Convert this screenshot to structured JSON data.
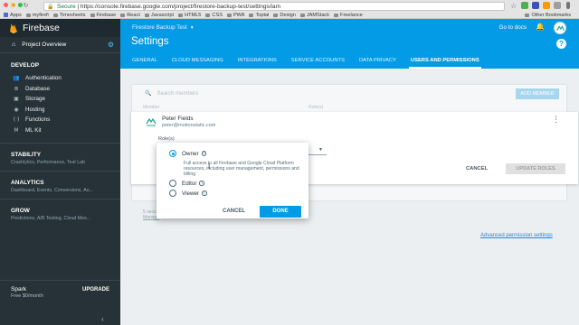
{
  "browser": {
    "url_prefix": "Secure",
    "url": "https://console.firebase.google.com/project/firestore-backup-test/settings/iam",
    "bookmarks": [
      "Apps",
      "myfirefi",
      "Timesheets",
      "Firebase",
      "React",
      "Javascript",
      "HTML5",
      "CSS",
      "PWA",
      "Toptal",
      "Design",
      "JAMStack",
      "Freelance"
    ],
    "other_bookmarks": "Other Bookmarks"
  },
  "sidebar": {
    "brand": "Firebase",
    "project_overview": "Project Overview",
    "develop_title": "DEVELOP",
    "develop_items": [
      {
        "label": "Authentication",
        "icon": "authentication-icon"
      },
      {
        "label": "Database",
        "icon": "database-icon"
      },
      {
        "label": "Storage",
        "icon": "storage-icon"
      },
      {
        "label": "Hosting",
        "icon": "hosting-icon"
      },
      {
        "label": "Functions",
        "icon": "functions-icon"
      },
      {
        "label": "ML Kit",
        "icon": "ml-kit-icon"
      }
    ],
    "groups": [
      {
        "title": "STABILITY",
        "sub": "Crashlytics, Performance, Test Lab"
      },
      {
        "title": "ANALYTICS",
        "sub": "Dashboard, Events, Conversions, Au..."
      },
      {
        "title": "GROW",
        "sub": "Predictions, A/B Testing, Cloud Mes..."
      }
    ],
    "plan": "Spark",
    "price": "Free $0/month",
    "upgrade": "UPGRADE"
  },
  "header": {
    "project": "Firestore Backup Test",
    "go_to_docs": "Go to docs",
    "title": "Settings",
    "tabs": [
      "GENERAL",
      "CLOUD MESSAGING",
      "INTEGRATIONS",
      "SERVICE ACCOUNTS",
      "DATA PRIVACY",
      "USERS AND PERMISSIONS"
    ],
    "active_tab": "USERS AND PERMISSIONS"
  },
  "members": {
    "search_placeholder": "Search members",
    "add_member": "ADD MEMBER",
    "col_member": "Member",
    "col_role": "Role(s)",
    "summary": "5 secs",
    "summary2": "Manage"
  },
  "member": {
    "name": "Peter Fields",
    "email": "peter@motionstatic.com",
    "roles_label": "Role(s)",
    "cancel": "CANCEL",
    "update_roles": "UPDATE ROLES"
  },
  "dropdown": {
    "owner": "Owner",
    "owner_desc": "Full access to all Firebase and Google Cloud Platform resources, including user management, permissions and billing",
    "editor": "Editor",
    "viewer": "Viewer",
    "cancel": "CANCEL",
    "done": "DONE",
    "selected": "Owner"
  },
  "advanced_link": "Advanced permission settings",
  "colors": {
    "accent": "#039be5",
    "sidebar": "#263238"
  }
}
